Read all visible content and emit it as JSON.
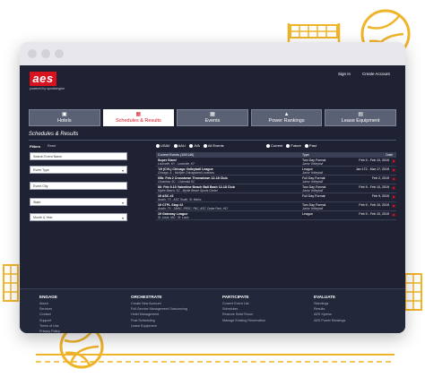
{
  "header": {
    "logo": "aes",
    "powered_by": "powered by sportsengine",
    "sign_in": "Sign In",
    "create_account": "Create Account"
  },
  "tabs": [
    {
      "label": "Hotels",
      "icon": "hotel-icon"
    },
    {
      "label": "Schedules & Results",
      "icon": "calendar-icon"
    },
    {
      "label": "Events",
      "icon": "calendar-icon"
    },
    {
      "label": "Power Rankings",
      "icon": "chart-icon"
    },
    {
      "label": "Lease Equipment",
      "icon": "equipment-icon"
    }
  ],
  "section_title": "Schedules & Results",
  "filters": {
    "label": "Filters",
    "reset": "Reset",
    "event_name_placeholder": "Search Event Name",
    "event_type": "Event Type",
    "event_city": "Event City",
    "state": "State",
    "month_year": "Month & Year"
  },
  "org_filters": [
    "USAV",
    "AAU",
    "JVA",
    "All Events"
  ],
  "time_filters": [
    "Current",
    "Future",
    "Past"
  ],
  "table": {
    "header_label": "Current Events (100/146)",
    "col_type": "Type",
    "col_date": "Date",
    "rows": [
      {
        "name": "Super Slam!",
        "location": "Louisville, KY - Louisville, KY",
        "type": "Two Day Format",
        "type2": "Junior Volleyball",
        "date": "Feb 9 - Feb 10, 2019"
      },
      {
        "name": "'19 (CVL) Chicago Volleyball League",
        "location": "Chicago, IL - Multiple Chicagoland Locations",
        "type": "League",
        "type2": "Junior Volleyball",
        "date": "Jan 172 - Mar 17, 2019"
      },
      {
        "name": "05b: Feb 2 Crosstown Throwdown 12-18 Club",
        "location": "Columbia, SC - Columbia SC",
        "type": "Full Day Format",
        "type2": "Junior Volleyball",
        "date": "Feb 2, 2019"
      },
      {
        "name": "06: Feb 9-10 Valentine Beach Ball Bash 12-18 Club",
        "location": "Myrtle Beach, SC - Myrtle Beach Sports Center",
        "type": "Two Day Format",
        "type2": "Junior Volleyball",
        "date": "Feb 9 - Feb 10, 2019"
      },
      {
        "name": "19 ASC #2",
        "location": "Austin, TX - ASC South, St. Marks",
        "type": "Full Day Format",
        "type2": "",
        "date": "Feb 9, 2019"
      },
      {
        "name": "19 CTPL Stop #2",
        "location": "Austin, TX - SMAC, RRSC, PAC, ASC Cedar Park, HCI",
        "type": "Two Day Format",
        "type2": "Junior Volleyball",
        "date": "Feb 9 - Feb 10, 2019"
      },
      {
        "name": "19 Gateway League",
        "location": "St. Louis, MO - St. Louis",
        "type": "League",
        "type2": "",
        "date": "Feb 9 - Feb 10, 2019"
      }
    ]
  },
  "footer": {
    "columns": [
      {
        "title": "ENGAGE",
        "items": [
          "About",
          "Services",
          "Contact",
          "Support",
          "Terms of Use",
          "Privacy Policy"
        ]
      },
      {
        "title": "ORCHESTRATE",
        "items": [
          "Create New Account",
          "Full-Service Management Outsourcing",
          "Hotel Management",
          "Post Scheduling",
          "Lease Equipment"
        ]
      },
      {
        "title": "PARTICIPATE",
        "items": [
          "Current Event List",
          "Schedules",
          "Reserve Hotel Room",
          "Manage Existing Reservation"
        ]
      },
      {
        "title": "EVALUATE",
        "items": [
          "Standings",
          "Results",
          "AES Xpress",
          "AES Power Rankings"
        ]
      }
    ]
  },
  "colors": {
    "brand_red": "#d9121f",
    "navy": "#1e2233",
    "deco_gold": "#f0b429"
  }
}
